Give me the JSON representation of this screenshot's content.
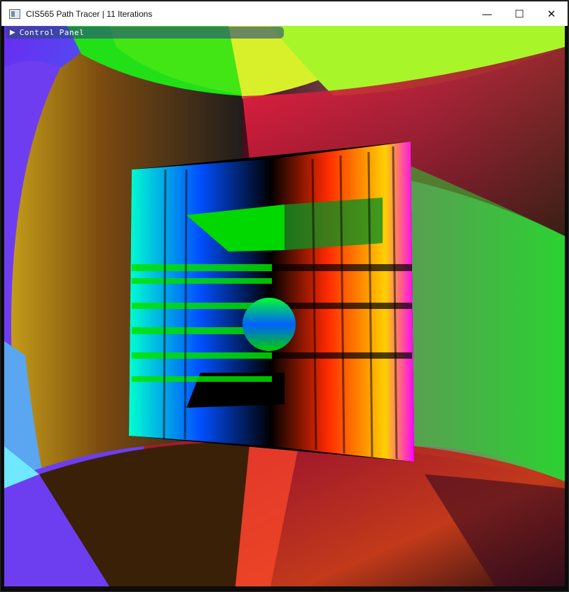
{
  "window": {
    "title": "CIS565 Path Tracer | 11 Iterations",
    "minimize_glyph": "—",
    "maximize_glyph": "☐",
    "close_glyph": "✕"
  },
  "control_panel": {
    "arrow": "▶",
    "label": "Control Panel"
  },
  "render": {
    "description_colors": {
      "top_left": "#8a3cf5",
      "top_center": "#35e21a",
      "top_right": "#e9f51f",
      "left_wall": "#e8a61a",
      "right_wall": "#30d832",
      "ceiling_floor_red": "#ff2f4d",
      "center_black": "#000000"
    }
  }
}
